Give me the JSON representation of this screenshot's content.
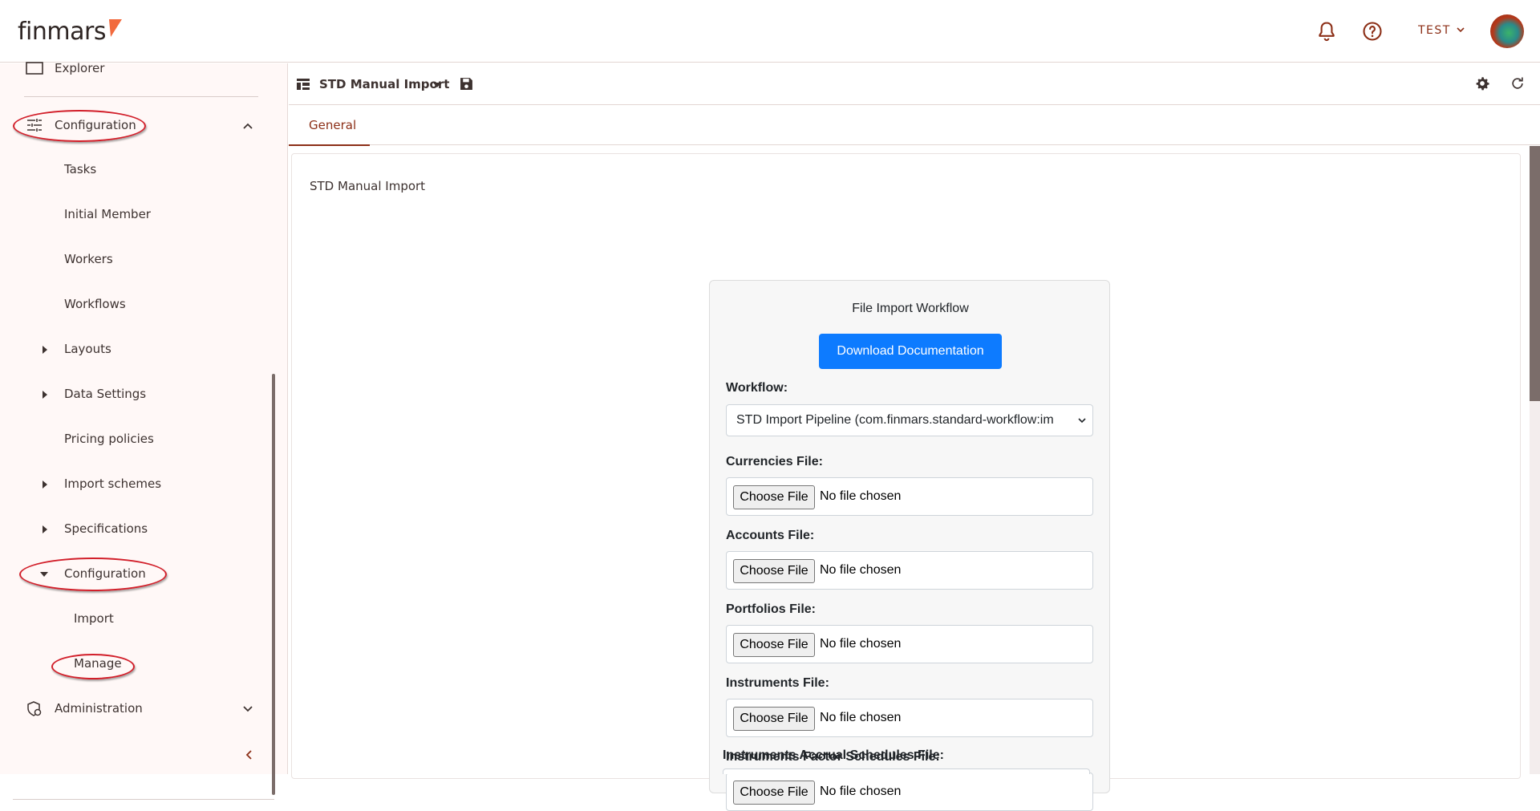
{
  "header": {
    "logo_text": "finmars",
    "user_name": "TEST"
  },
  "sidebar": {
    "explorer": "Explorer",
    "configuration": "Configuration",
    "items": {
      "tasks": "Tasks",
      "initial_member": "Initial Member",
      "workers": "Workers",
      "workflows": "Workflows",
      "layouts": "Layouts",
      "data_settings": "Data Settings",
      "pricing_policies": "Pricing policies",
      "import_schemes": "Import schemes",
      "specifications": "Specifications",
      "configuration_sub": "Configuration",
      "import": "Import",
      "manage": "Manage"
    },
    "administration": "Administration"
  },
  "toolbar": {
    "title": "STD Manual Import"
  },
  "tabs": {
    "general": "General"
  },
  "panel": {
    "title": "STD Manual Import"
  },
  "card": {
    "title": "File Import Workflow",
    "download_button": "Download Documentation",
    "workflow_label": "Workflow:",
    "workflow_value": "STD Import Pipeline (com.finmars.standard-workflow:im",
    "choose_file_label": "Choose File",
    "no_file_text": "No file chosen",
    "files": [
      {
        "label": "Currencies File:"
      },
      {
        "label": "Accounts File:"
      },
      {
        "label": "Portfolios File:"
      },
      {
        "label": "Instruments File:"
      },
      {
        "label": "Instruments Factor Schedules File:"
      },
      {
        "label": "Instruments Accrual Schedules File:"
      }
    ]
  },
  "colors": {
    "accent": "#8c2f17",
    "primary_button": "#0d7bff",
    "annotation_oval": "#d21f2a"
  }
}
